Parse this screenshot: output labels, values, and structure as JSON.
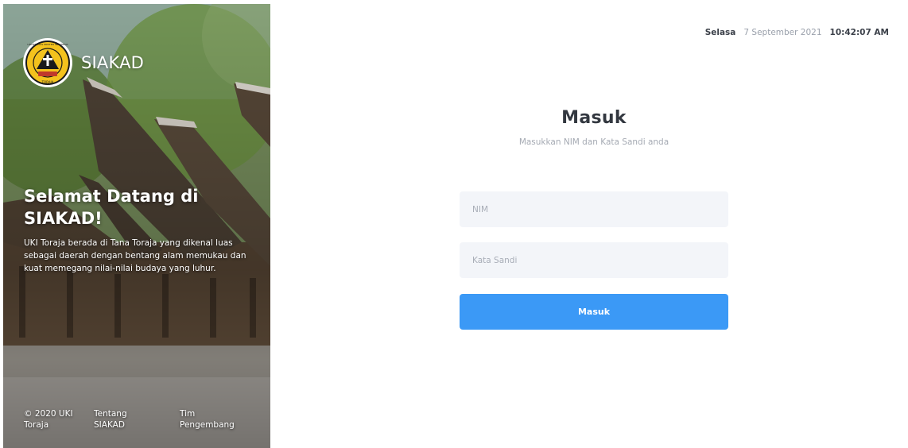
{
  "brand": {
    "name": "SIAKAD",
    "logo_icon": "university-seal-icon",
    "logo_ring_text": "UNIVERSITAS KRISTEN INDONESIA",
    "logo_bottom_text": "TORAJA"
  },
  "hero": {
    "title": "Selamat Datang di SIAKAD!",
    "description": "UKI Toraja berada di Tana Toraja yang dikenal luas sebagai daerah dengan bentang alam memukau dan kuat memegang nilai-nilai budaya yang luhur.",
    "footer": {
      "copyright": "© 2020 UKI Toraja",
      "about_link": "Tentang SIAKAD",
      "team_link": "Tim Pengembang"
    }
  },
  "datetime": {
    "day": "Selasa",
    "date": "7 September 2021",
    "time": "10:42:07 AM"
  },
  "login": {
    "title": "Masuk",
    "subtitle": "Masukkan NIM dan Kata Sandi anda",
    "nim_placeholder": "NIM",
    "nim_value": "",
    "password_placeholder": "Kata Sandi",
    "password_value": "",
    "submit_label": "Masuk"
  },
  "colors": {
    "accent": "#3b99f6",
    "input_bg": "#f3f5f9",
    "title_text": "#333840",
    "muted_text": "#a5aab3"
  }
}
